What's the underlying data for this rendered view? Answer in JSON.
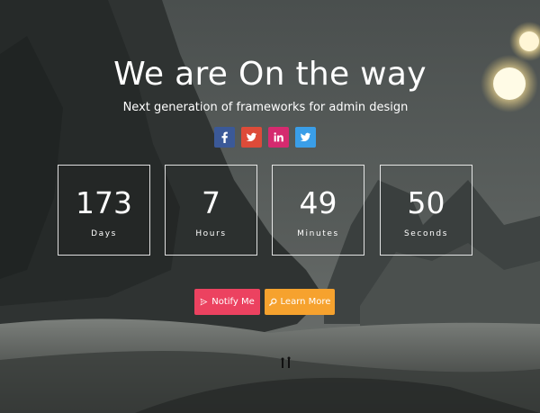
{
  "hero": {
    "title": "We are On the way",
    "subtitle": "Next generation of frameworks for admin design"
  },
  "social": [
    {
      "name": "facebook",
      "glyph": "f",
      "color": "#3b5998",
      "icon": "facebook-icon"
    },
    {
      "name": "google-plus",
      "glyph": "",
      "color": "#dd4b39",
      "icon": "twitter-bird-icon"
    },
    {
      "name": "linkedin",
      "glyph": "in",
      "color": "#d52a6f",
      "icon": "linkedin-icon"
    },
    {
      "name": "twitter",
      "glyph": "",
      "color": "#3a9ee8",
      "icon": "twitter-icon"
    }
  ],
  "countdown": [
    {
      "value": "173",
      "label": "Days"
    },
    {
      "value": "7",
      "label": "Hours"
    },
    {
      "value": "49",
      "label": "Minutes"
    },
    {
      "value": "50",
      "label": "Seconds"
    }
  ],
  "buttons": {
    "notify_label": "Notify Me",
    "notify_color": "#ec4260",
    "notify_icon": "paper-plane-icon",
    "learn_label": "Learn More",
    "learn_color": "#f6a22e",
    "learn_icon": "search-icon"
  }
}
